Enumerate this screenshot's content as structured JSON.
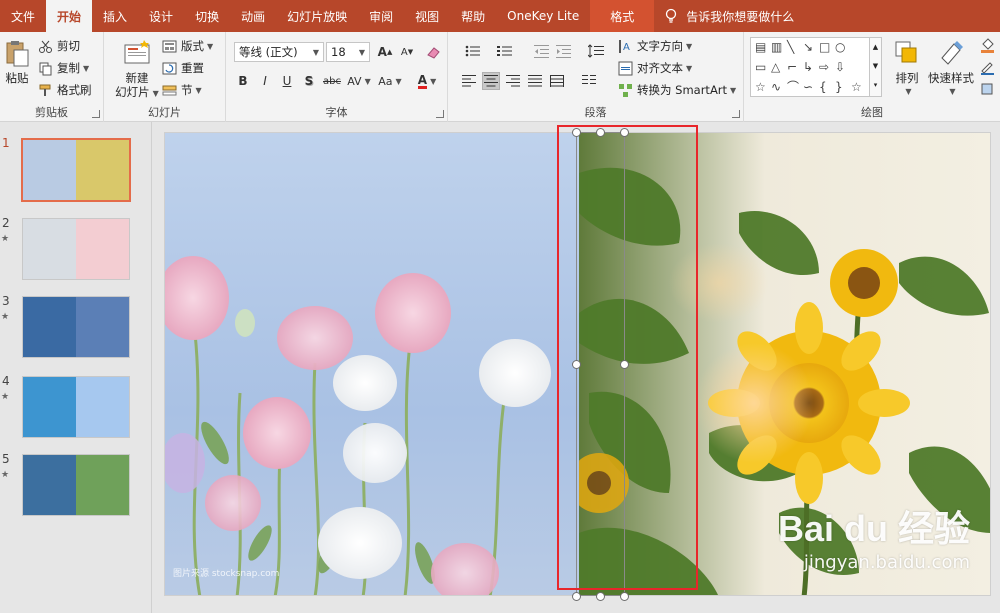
{
  "tabs": [
    {
      "label": "文件",
      "active": false
    },
    {
      "label": "开始",
      "active": true
    },
    {
      "label": "插入",
      "active": false
    },
    {
      "label": "设计",
      "active": false
    },
    {
      "label": "切换",
      "active": false
    },
    {
      "label": "动画",
      "active": false
    },
    {
      "label": "幻灯片放映",
      "active": false
    },
    {
      "label": "审阅",
      "active": false
    },
    {
      "label": "视图",
      "active": false
    },
    {
      "label": "帮助",
      "active": false
    },
    {
      "label": "OneKey Lite",
      "active": false
    },
    {
      "label": "格式",
      "active": false,
      "context": true
    }
  ],
  "tell_me": "告诉我你想要做什么",
  "ribbon": {
    "clipboard": {
      "label": "剪贴板",
      "paste": "粘贴",
      "cut": "剪切",
      "copy": "复制",
      "format_painter": "格式刷"
    },
    "slides": {
      "label": "幻灯片",
      "new_slide_line1": "新建",
      "new_slide_line2": "幻灯片",
      "layout": "版式",
      "reset": "重置",
      "section": "节"
    },
    "font": {
      "label": "字体",
      "font_name": "等线 (正文)",
      "font_size": "18",
      "grow": "A",
      "shrink": "A",
      "bold": "B",
      "italic": "I",
      "underline": "U",
      "shadow": "S",
      "strikethrough": "abc",
      "spacing": "AV",
      "case": "Aa",
      "color": "A"
    },
    "paragraph": {
      "label": "段落",
      "text_direction": "文字方向",
      "align_text": "对齐文本",
      "smartart": "转换为 SmartArt"
    },
    "drawing": {
      "label": "绘图",
      "arrange": "排列",
      "quick_styles": "快速样式"
    }
  },
  "slides": [
    {
      "number": "1",
      "active": true,
      "star": "",
      "left_color": "#b9cbe3",
      "right_color": "#d9c86a"
    },
    {
      "number": "2",
      "active": false,
      "star": "★",
      "left_color": "#d8dde3",
      "right_color": "#f3cdd2"
    },
    {
      "number": "3",
      "active": false,
      "star": "★",
      "left_color": "#3a6aa3",
      "right_color": "#5b7fb6"
    },
    {
      "number": "4",
      "active": false,
      "star": "★",
      "left_color": "#3d95d0",
      "right_color": "#a6c8ef"
    },
    {
      "number": "5",
      "active": false,
      "star": "★",
      "left_color": "#3c6f9f",
      "right_color": "#6fa15a"
    }
  ],
  "canvas": {
    "left_watermark": "图片来源 stocksnap.com",
    "baidu_brand": "Bai du 经验",
    "baidu_url": "jingyan.baidu.com"
  },
  "colors": {
    "accent": "#b7472a",
    "highlight": "#e8262b"
  }
}
